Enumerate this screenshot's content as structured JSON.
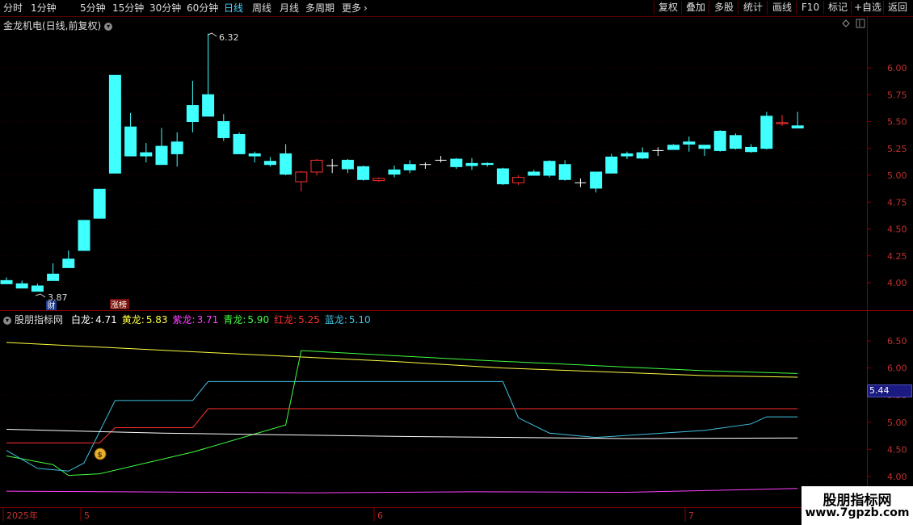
{
  "toolbar": {
    "periods": [
      "分时",
      "1分钟",
      "5分钟",
      "15分钟",
      "30分钟",
      "60分钟",
      "日线",
      "周线",
      "月线",
      "多周期",
      "更多"
    ],
    "active_period": "日线",
    "more_icon": "chevron-right-icon",
    "right_buttons": [
      "复权",
      "叠加",
      "多股",
      "统计",
      "画线",
      "F10",
      "标记",
      "+自选",
      "返回"
    ]
  },
  "main_chart": {
    "title": "金龙机电(日线,前复权)",
    "dropdown_icon": "chevron-down-icon",
    "high_label": "6.32",
    "low_label": "3.87",
    "badge_cai": "财",
    "badge_zhangting": "涨榜",
    "diamond_icon": "diamond-icon",
    "y_ticks": [
      "6.00",
      "5.75",
      "5.50",
      "5.25",
      "5.00",
      "4.75",
      "4.50",
      "4.25",
      "4.00"
    ]
  },
  "indicator": {
    "name": "股朋指标网",
    "lines": [
      {
        "label": "白龙:",
        "value": "4.71",
        "color": "#ffffff"
      },
      {
        "label": "黄龙:",
        "value": "5.83",
        "color": "#ffff40"
      },
      {
        "label": "紫龙:",
        "value": "3.71",
        "color": "#ff40ff"
      },
      {
        "label": "青龙:",
        "value": "5.90",
        "color": "#40ff40"
      },
      {
        "label": "红龙:",
        "value": "5.25",
        "color": "#ff3030"
      },
      {
        "label": "蓝龙:",
        "value": "5.10",
        "color": "#40c0e0"
      }
    ],
    "y_ticks": [
      "6.50",
      "6.00",
      "5.50",
      "5.00",
      "4.50",
      "4.00"
    ],
    "price_tag": "5.44",
    "money_icon": "money-bag-icon"
  },
  "x_axis": {
    "labels": [
      "2025年",
      "5",
      "6",
      "7"
    ]
  },
  "watermark": {
    "title": "股朋指标网",
    "url": "www.7gpzb.com"
  },
  "colors": {
    "up": "#ff3030",
    "down": "#40ffff",
    "active_tab": "#4dd2ff"
  },
  "candles": [
    [
      4.02,
      4.05,
      4.02,
      3.99
    ],
    [
      3.99,
      4.02,
      3.97,
      3.95
    ],
    [
      3.97,
      3.99,
      3.94,
      3.92
    ],
    [
      4.08,
      4.18,
      4.02,
      4.02
    ],
    [
      4.22,
      4.3,
      4.14,
      4.14
    ],
    [
      4.58,
      4.58,
      4.3,
      4.3
    ],
    [
      4.87,
      4.87,
      4.6,
      4.6
    ],
    [
      5.93,
      5.93,
      5.02,
      5.02
    ],
    [
      5.45,
      5.58,
      5.18,
      5.18
    ],
    [
      5.21,
      5.3,
      5.12,
      5.18
    ],
    [
      5.27,
      5.44,
      5.1,
      5.1
    ],
    [
      5.31,
      5.4,
      5.08,
      5.2
    ],
    [
      5.65,
      5.88,
      5.4,
      5.5
    ],
    [
      5.75,
      6.32,
      5.55,
      5.55
    ],
    [
      5.5,
      5.57,
      5.32,
      5.35
    ],
    [
      5.38,
      5.4,
      5.2,
      5.2
    ],
    [
      5.2,
      5.22,
      5.12,
      5.18
    ],
    [
      5.13,
      5.17,
      5.08,
      5.1
    ],
    [
      5.2,
      5.29,
      5.0,
      5.01
    ],
    [
      4.94,
      5.04,
      4.85,
      5.03
    ],
    [
      5.03,
      5.15,
      5.0,
      5.14
    ],
    [
      5.09,
      5.15,
      5.02,
      5.09
    ],
    [
      5.14,
      5.15,
      5.02,
      5.06
    ],
    [
      5.08,
      5.09,
      4.95,
      4.96
    ],
    [
      4.95,
      4.98,
      4.94,
      4.97
    ],
    [
      5.05,
      5.09,
      4.98,
      5.01
    ],
    [
      5.1,
      5.14,
      5.02,
      5.05
    ],
    [
      5.1,
      5.12,
      5.06,
      5.1
    ],
    [
      5.14,
      5.18,
      5.12,
      5.14
    ],
    [
      5.15,
      5.16,
      5.06,
      5.08
    ],
    [
      5.11,
      5.16,
      5.05,
      5.09
    ],
    [
      5.11,
      5.12,
      5.08,
      5.1
    ],
    [
      5.06,
      5.07,
      4.91,
      4.92
    ],
    [
      4.93,
      5.0,
      4.91,
      4.98
    ],
    [
      5.03,
      5.05,
      5.0,
      5.0
    ],
    [
      5.13,
      5.14,
      4.98,
      5.0
    ],
    [
      5.1,
      5.14,
      4.95,
      4.96
    ],
    [
      4.93,
      4.97,
      4.89,
      4.93
    ],
    [
      5.03,
      5.03,
      4.84,
      4.88
    ],
    [
      5.17,
      5.2,
      5.02,
      5.02
    ],
    [
      5.2,
      5.22,
      5.15,
      5.18
    ],
    [
      5.21,
      5.26,
      5.15,
      5.16
    ],
    [
      5.23,
      5.26,
      5.18,
      5.23
    ],
    [
      5.28,
      5.29,
      5.24,
      5.24
    ],
    [
      5.31,
      5.36,
      5.22,
      5.29
    ],
    [
      5.28,
      5.28,
      5.18,
      5.25
    ],
    [
      5.41,
      5.42,
      5.22,
      5.23
    ],
    [
      5.37,
      5.39,
      5.24,
      5.25
    ],
    [
      5.26,
      5.29,
      5.21,
      5.22
    ],
    [
      5.55,
      5.59,
      5.24,
      5.25
    ],
    [
      5.48,
      5.56,
      5.46,
      5.49
    ],
    [
      5.46,
      5.59,
      5.44,
      5.44
    ]
  ]
}
